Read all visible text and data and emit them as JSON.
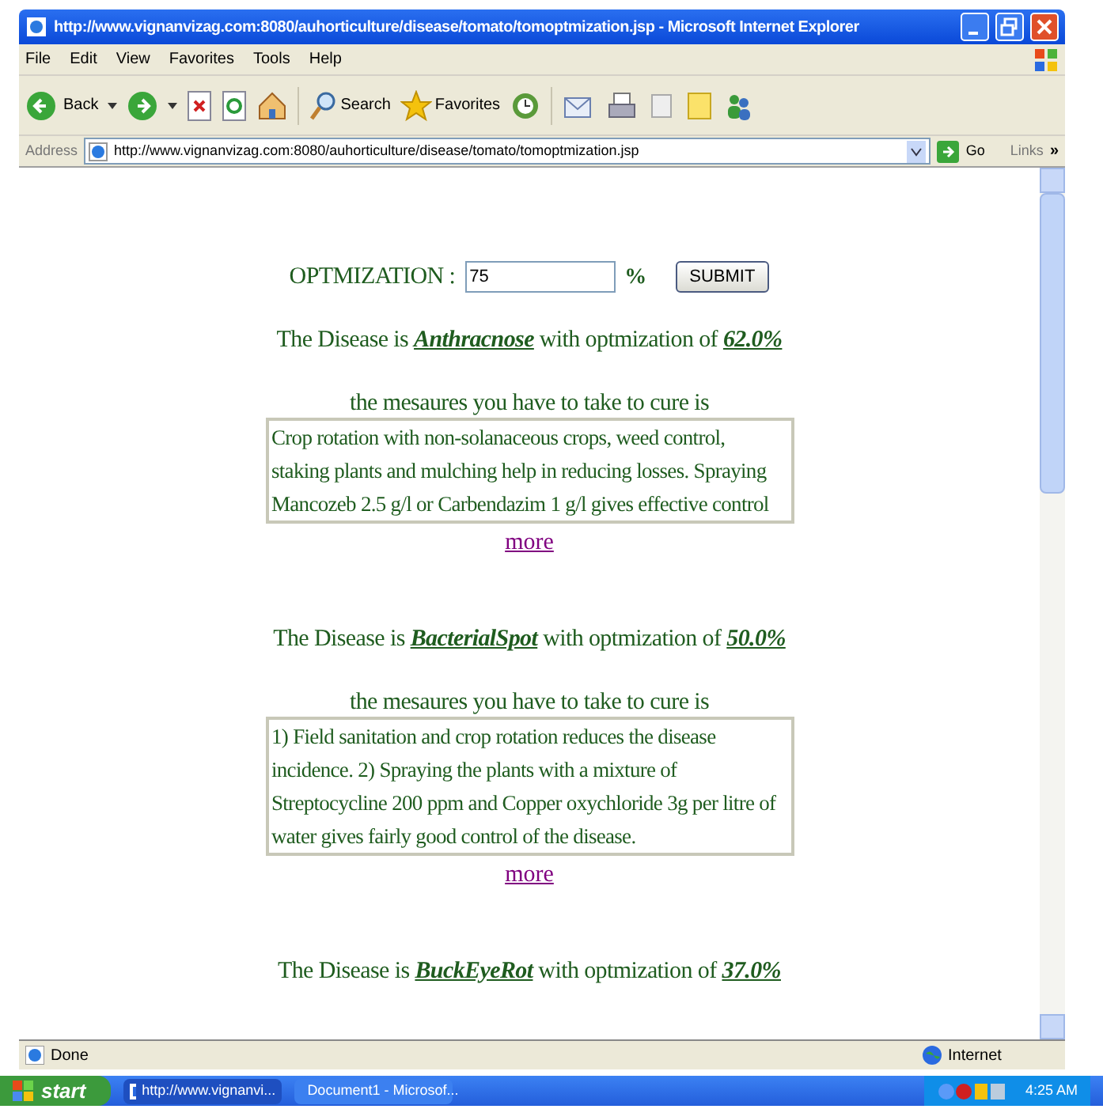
{
  "window": {
    "title": "http://www.vignanvizag.com:8080/auhorticulture/disease/tomato/tomoptmization.jsp - Microsoft Internet Explorer"
  },
  "menu_bar": [
    "File",
    "Edit",
    "View",
    "Favorites",
    "Tools",
    "Help"
  ],
  "toolbar": {
    "back": "Back",
    "search": "Search",
    "favorites": "Favorites"
  },
  "address_bar": {
    "label": "Address",
    "url": "http://www.vignanvizag.com:8080/auhorticulture/disease/tomato/tomoptmization.jsp",
    "go": "Go",
    "links": "Links",
    "more": "»"
  },
  "form": {
    "label": "OPTMIZATION :",
    "value": "75",
    "unit": "%",
    "submit": "SUBMIT"
  },
  "results": [
    {
      "prefix": "The Disease is",
      "disease": "Anthracnose",
      "middle": "with optmization of",
      "percent": "62.0%",
      "heading": "the mesaures you have to take to cure is",
      "measures": "Crop rotation with non-solanaceous crops, weed control, staking plants and mulching help in reducing losses. Spraying Mancozeb 2.5 g/l or Carbendazim 1 g/l gives effective control",
      "link": "more"
    },
    {
      "prefix": "The Disease is",
      "disease": "BacterialSpot",
      "middle": "with optmization of",
      "percent": "50.0%",
      "heading": "the mesaures you have to take to cure is",
      "measures": "1) Field sanitation and crop rotation reduces the disease incidence. 2) Spraying the plants with a mixture of Streptocycline 200 ppm and Copper oxychloride 3g per litre of water gives fairly good control of the disease.",
      "link": "more"
    },
    {
      "prefix": "The Disease is",
      "disease": "BuckEyeRot",
      "middle": "with optmization of",
      "percent": "37.0%"
    }
  ],
  "status_bar": {
    "text": "Done",
    "zone": "Internet"
  },
  "taskbar": {
    "start": "start",
    "tasks": [
      {
        "label": "http://www.vignanvi...",
        "selected": true
      },
      {
        "label": "Document1 - Microsof...",
        "selected": false
      }
    ],
    "clock": "4:25 AM"
  }
}
